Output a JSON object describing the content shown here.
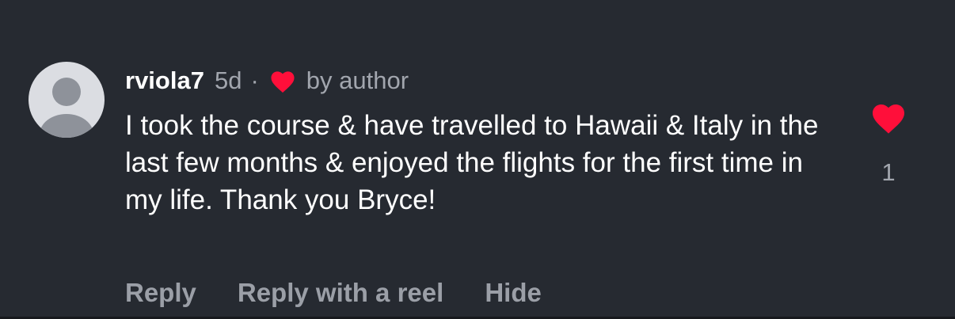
{
  "comment": {
    "username": "rviola7",
    "timestamp": "5d",
    "separator": "·",
    "author_like_label": "by author",
    "text": "I took the course & have travelled to Hawaii & Italy in the last few months & enjoyed the flights for the first time in my life. Thank you Bryce!",
    "avatar_icon": "default-avatar-icon"
  },
  "actions": {
    "reply": "Reply",
    "reply_with_reel": "Reply with a reel",
    "hide": "Hide"
  },
  "likes": {
    "count": "1",
    "icon": "heart-filled-icon",
    "liked": true
  },
  "colors": {
    "background": "#262a31",
    "heart": "#ff0f3a",
    "primary_text": "#ffffff",
    "secondary_text": "#a2a6ae",
    "avatar_bg": "#dbdde2",
    "avatar_fg": "#8e929a"
  }
}
